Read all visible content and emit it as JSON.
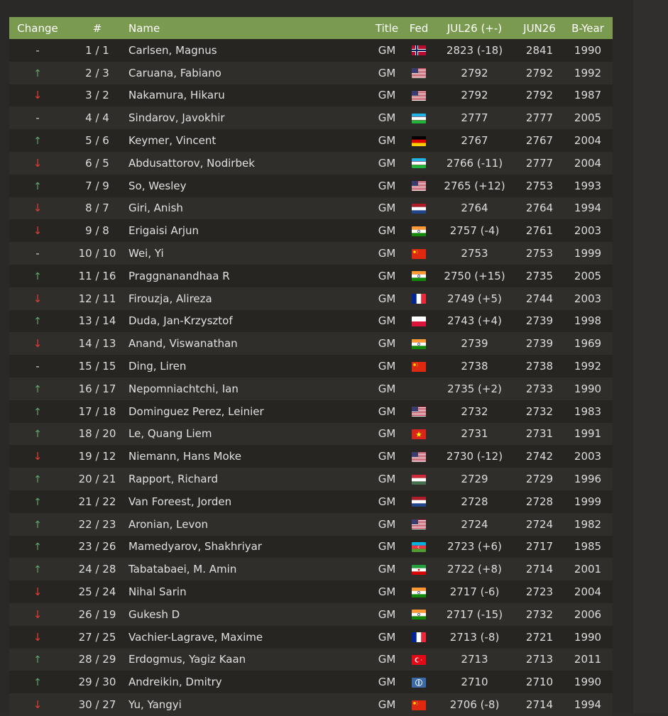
{
  "header": {
    "change": "Change",
    "rank": "#",
    "name": "Name",
    "title": "Title",
    "fed": "Fed",
    "current": "JUL26 (+-)",
    "previous": "JUN26",
    "byear": "B-Year"
  },
  "colors": {
    "header_bg": "#7a9a50",
    "up": "#5fa86a",
    "down": "#e03c31"
  },
  "rows": [
    {
      "change": "-",
      "dir": "same",
      "rank": "1 / 1",
      "name": "Carlsen, Magnus",
      "title": "GM",
      "fed": "NOR",
      "rating": "2823 (-18)",
      "prev": "2841",
      "byear": "1990"
    },
    {
      "change": "↑",
      "dir": "up",
      "rank": "2 / 3",
      "name": "Caruana, Fabiano",
      "title": "GM",
      "fed": "USA",
      "rating": "2792",
      "prev": "2792",
      "byear": "1992"
    },
    {
      "change": "↓",
      "dir": "down",
      "rank": "3 / 2",
      "name": "Nakamura, Hikaru",
      "title": "GM",
      "fed": "USA",
      "rating": "2792",
      "prev": "2792",
      "byear": "1987"
    },
    {
      "change": "-",
      "dir": "same",
      "rank": "4 / 4",
      "name": "Sindarov, Javokhir",
      "title": "GM",
      "fed": "UZB",
      "rating": "2777",
      "prev": "2777",
      "byear": "2005"
    },
    {
      "change": "↑",
      "dir": "up",
      "rank": "5 / 6",
      "name": "Keymer, Vincent",
      "title": "GM",
      "fed": "GER",
      "rating": "2767",
      "prev": "2767",
      "byear": "2004"
    },
    {
      "change": "↓",
      "dir": "down",
      "rank": "6 / 5",
      "name": "Abdusattorov, Nodirbek",
      "title": "GM",
      "fed": "UZB",
      "rating": "2766 (-11)",
      "prev": "2777",
      "byear": "2004"
    },
    {
      "change": "↑",
      "dir": "up",
      "rank": "7 / 9",
      "name": "So, Wesley",
      "title": "GM",
      "fed": "USA",
      "rating": "2765 (+12)",
      "prev": "2753",
      "byear": "1993"
    },
    {
      "change": "↓",
      "dir": "down",
      "rank": "8 / 7",
      "name": "Giri, Anish",
      "title": "GM",
      "fed": "NED",
      "rating": "2764",
      "prev": "2764",
      "byear": "1994"
    },
    {
      "change": "↓",
      "dir": "down",
      "rank": "9 / 8",
      "name": "Erigaisi Arjun",
      "title": "GM",
      "fed": "IND",
      "rating": "2757 (-4)",
      "prev": "2761",
      "byear": "2003"
    },
    {
      "change": "-",
      "dir": "same",
      "rank": "10 / 10",
      "name": "Wei, Yi",
      "title": "GM",
      "fed": "CHN",
      "rating": "2753",
      "prev": "2753",
      "byear": "1999"
    },
    {
      "change": "↑",
      "dir": "up",
      "rank": "11 / 16",
      "name": "Praggnanandhaa R",
      "title": "GM",
      "fed": "IND",
      "rating": "2750 (+15)",
      "prev": "2735",
      "byear": "2005"
    },
    {
      "change": "↓",
      "dir": "down",
      "rank": "12 / 11",
      "name": "Firouzja, Alireza",
      "title": "GM",
      "fed": "FRA",
      "rating": "2749 (+5)",
      "prev": "2744",
      "byear": "2003"
    },
    {
      "change": "↑",
      "dir": "up",
      "rank": "13 / 14",
      "name": "Duda, Jan-Krzysztof",
      "title": "GM",
      "fed": "POL",
      "rating": "2743 (+4)",
      "prev": "2739",
      "byear": "1998"
    },
    {
      "change": "↓",
      "dir": "down",
      "rank": "14 / 13",
      "name": "Anand, Viswanathan",
      "title": "GM",
      "fed": "IND",
      "rating": "2739",
      "prev": "2739",
      "byear": "1969"
    },
    {
      "change": "-",
      "dir": "same",
      "rank": "15 / 15",
      "name": "Ding, Liren",
      "title": "GM",
      "fed": "CHN",
      "rating": "2738",
      "prev": "2738",
      "byear": "1992"
    },
    {
      "change": "↑",
      "dir": "up",
      "rank": "16 / 17",
      "name": "Nepomniachtchi, Ian",
      "title": "GM",
      "fed": "",
      "rating": "2735 (+2)",
      "prev": "2733",
      "byear": "1990"
    },
    {
      "change": "↑",
      "dir": "up",
      "rank": "17 / 18",
      "name": "Dominguez Perez, Leinier",
      "title": "GM",
      "fed": "USA",
      "rating": "2732",
      "prev": "2732",
      "byear": "1983"
    },
    {
      "change": "↑",
      "dir": "up",
      "rank": "18 / 20",
      "name": "Le, Quang Liem",
      "title": "GM",
      "fed": "VIE",
      "rating": "2731",
      "prev": "2731",
      "byear": "1991"
    },
    {
      "change": "↓",
      "dir": "down",
      "rank": "19 / 12",
      "name": "Niemann, Hans Moke",
      "title": "GM",
      "fed": "USA",
      "rating": "2730 (-12)",
      "prev": "2742",
      "byear": "2003"
    },
    {
      "change": "↑",
      "dir": "up",
      "rank": "20 / 21",
      "name": "Rapport, Richard",
      "title": "GM",
      "fed": "HUN",
      "rating": "2729",
      "prev": "2729",
      "byear": "1996"
    },
    {
      "change": "↑",
      "dir": "up",
      "rank": "21 / 22",
      "name": "Van Foreest, Jorden",
      "title": "GM",
      "fed": "NED",
      "rating": "2728",
      "prev": "2728",
      "byear": "1999"
    },
    {
      "change": "↑",
      "dir": "up",
      "rank": "22 / 23",
      "name": "Aronian, Levon",
      "title": "GM",
      "fed": "USA",
      "rating": "2724",
      "prev": "2724",
      "byear": "1982"
    },
    {
      "change": "↑",
      "dir": "up",
      "rank": "23 / 26",
      "name": "Mamedyarov, Shakhriyar",
      "title": "GM",
      "fed": "AZE",
      "rating": "2723 (+6)",
      "prev": "2717",
      "byear": "1985"
    },
    {
      "change": "↑",
      "dir": "up",
      "rank": "24 / 28",
      "name": "Tabatabaei, M. Amin",
      "title": "GM",
      "fed": "IRI",
      "rating": "2722 (+8)",
      "prev": "2714",
      "byear": "2001"
    },
    {
      "change": "↓",
      "dir": "down",
      "rank": "25 / 24",
      "name": "Nihal Sarin",
      "title": "GM",
      "fed": "IND",
      "rating": "2717 (-6)",
      "prev": "2723",
      "byear": "2004"
    },
    {
      "change": "↓",
      "dir": "down",
      "rank": "26 / 19",
      "name": "Gukesh D",
      "title": "GM",
      "fed": "IND",
      "rating": "2717 (-15)",
      "prev": "2732",
      "byear": "2006"
    },
    {
      "change": "↓",
      "dir": "down",
      "rank": "27 / 25",
      "name": "Vachier-Lagrave, Maxime",
      "title": "GM",
      "fed": "FRA",
      "rating": "2713 (-8)",
      "prev": "2721",
      "byear": "1990"
    },
    {
      "change": "↑",
      "dir": "up",
      "rank": "28 / 29",
      "name": "Erdogmus, Yagiz Kaan",
      "title": "GM",
      "fed": "TUR",
      "rating": "2713",
      "prev": "2713",
      "byear": "2011"
    },
    {
      "change": "↑",
      "dir": "up",
      "rank": "29 / 30",
      "name": "Andreikin, Dmitry",
      "title": "GM",
      "fed": "FID",
      "rating": "2710",
      "prev": "2710",
      "byear": "1990"
    },
    {
      "change": "↓",
      "dir": "down",
      "rank": "30 / 27",
      "name": "Yu, Yangyi",
      "title": "GM",
      "fed": "CHN",
      "rating": "2706 (-8)",
      "prev": "2714",
      "byear": "1994"
    }
  ]
}
